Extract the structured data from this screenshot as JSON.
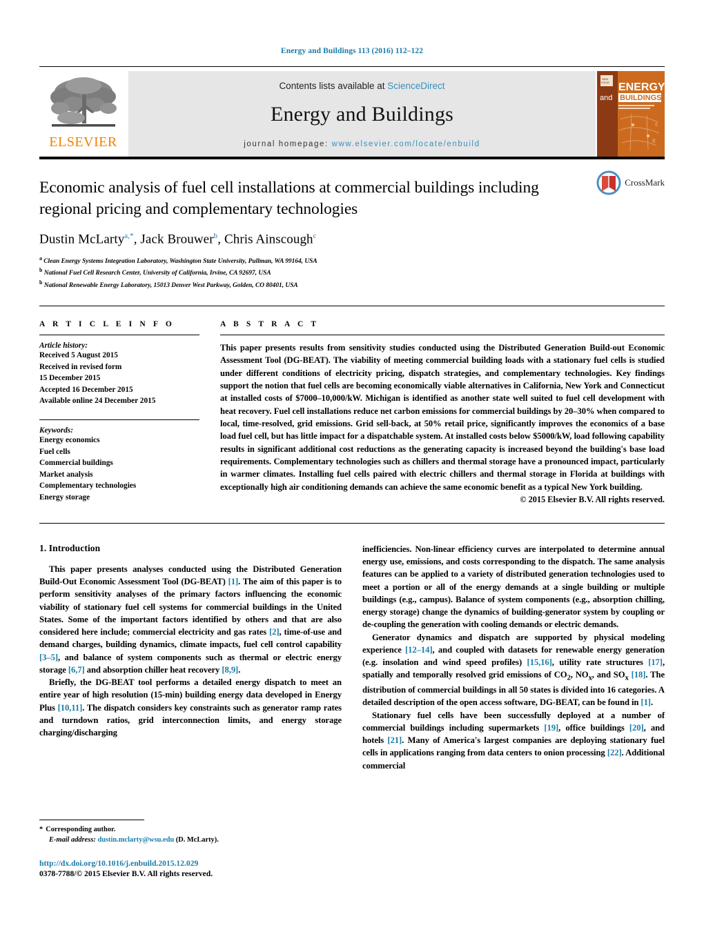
{
  "running_head": "Energy and Buildings 113 (2016) 112–122",
  "masthead": {
    "publisher_name": "ELSEVIER",
    "contents_prefix": "Contents lists available at ",
    "contents_link": "ScienceDirect",
    "journal_title": "Energy and Buildings",
    "homepage_prefix": "journal homepage: ",
    "homepage_url": "www.elsevier.com/locate/enbuild",
    "cover_line1": "ENERGY",
    "cover_line2": "and",
    "cover_line3": "BUILDINGS"
  },
  "article": {
    "title": "Economic analysis of fuel cell installations at commercial buildings including regional pricing and complementary technologies",
    "authors_html": "Dustin McLarty<sup>a,*</sup>, Jack Brouwer<sup>b</sup>, Chris Ainscough<sup>c</sup>",
    "affiliations": [
      {
        "marker": "a",
        "text": "Clean Energy Systems Integration Laboratory, Washington State University, Pullman, WA 99164, USA"
      },
      {
        "marker": "b",
        "text": "National Fuel Cell Research Center, University of California, Irvine, CA 92697, USA"
      },
      {
        "marker": "b",
        "text": "National Renewable Energy Laboratory, 15013 Denver West Parkway, Golden, CO 80401, USA"
      }
    ],
    "crossmark_label": "CrossMark"
  },
  "article_info": {
    "heading": "A R T I C L E   I N F O",
    "history_label": "Article history:",
    "history": [
      "Received 5 August 2015",
      "Received in revised form",
      "15 December 2015",
      "Accepted 16 December 2015",
      "Available online 24 December 2015"
    ],
    "keywords_label": "Keywords:",
    "keywords": [
      "Energy economics",
      "Fuel cells",
      "Commercial buildings",
      "Market analysis",
      "Complementary technologies",
      "Energy storage"
    ]
  },
  "abstract": {
    "heading": "A B S T R A C T",
    "text": "This paper presents results from sensitivity studies conducted using the Distributed Generation Build-out Economic Assessment Tool (DG-BEAT). The viability of meeting commercial building loads with a stationary fuel cells is studied under different conditions of electricity pricing, dispatch strategies, and complementary technologies. Key findings support the notion that fuel cells are becoming economically viable alternatives in California, New York and Connecticut at installed costs of $7000–10,000/kW. Michigan is identified as another state well suited to fuel cell development with heat recovery. Fuel cell installations reduce net carbon emissions for commercial buildings by 20–30% when compared to local, time-resolved, grid emissions. Grid sell-back, at 50% retail price, significantly improves the economics of a base load fuel cell, but has little impact for a dispatchable system. At installed costs below $5000/kW, load following capability results in significant additional cost reductions as the generating capacity is increased beyond the building's base load requirements. Complementary technologies such as chillers and thermal storage have a pronounced impact, particularly in warmer climates. Installing fuel cells paired with electric chillers and thermal storage in Florida at buildings with exceptionally high air conditioning demands can achieve the same economic benefit as a typical New York building.",
    "copyright": "© 2015 Elsevier B.V. All rights reserved."
  },
  "introduction": {
    "section_number_title": "1. Introduction",
    "left_paragraphs_html": [
      "This paper presents analyses conducted using the Distributed Generation Build-Out Economic Assessment Tool (DG-BEAT) <span class=\"cite\">[1]</span>. The aim of this paper is to perform sensitivity analyses of the primary factors influencing the economic viability of stationary fuel cell systems for commercial buildings in the United States. Some of the important factors identified by others and that are also considered here include; commercial electricity and gas rates <span class=\"cite\">[2]</span>, time-of-use and demand charges, building dynamics, climate impacts, fuel cell control capability <span class=\"cite\">[3–5]</span>, and balance of system components such as thermal or electric energy storage <span class=\"cite\">[6,7]</span> and absorption chiller heat recovery <span class=\"cite\">[8,9]</span>.",
      "Briefly, the DG-BEAT tool performs a detailed energy dispatch to meet an entire year of high resolution (15-min) building energy data developed in Energy Plus <span class=\"cite\">[10,11]</span>. The dispatch considers key constraints such as generator ramp rates and turndown ratios, grid interconnection limits, and energy storage charging/discharging"
    ],
    "right_paragraphs_html": [
      "inefficiencies. Non-linear efficiency curves are interpolated to determine annual energy use, emissions, and costs corresponding to the dispatch. The same analysis features can be applied to a variety of distributed generation technologies used to meet a portion or all of the energy demands at a single building or multiple buildings (e.g., campus). Balance of system components (e.g., absorption chilling, energy storage) change the dynamics of building-generator system by coupling or de-coupling the generation with cooling demands or electric demands.",
      "Generator dynamics and dispatch are supported by physical modeling experience <span class=\"cite\">[12–14]</span>, and coupled with datasets for renewable energy generation (e.g. insolation and wind speed profiles) <span class=\"cite\">[15,16]</span>, utility rate structures <span class=\"cite\">[17]</span>, spatially and temporally resolved grid emissions of CO<sub>2</sub>, NO<sub>x</sub>, and SO<sub>x</sub> <span class=\"cite\">[18]</span>. The distribution of commercial buildings in all 50 states is divided into 16 categories. A detailed description of the open access software, DG-BEAT, can be found in <span class=\"cite\">[1]</span>.",
      "Stationary fuel cells have been successfully deployed at a number of commercial buildings including supermarkets <span class=\"cite\">[19]</span>, office buildings <span class=\"cite\">[20]</span>, and hotels <span class=\"cite\">[21]</span>. Many of America's largest companies are deploying stationary fuel cells in applications ranging from data centers to onion processing <span class=\"cite\">[22]</span>. Additional commercial"
    ]
  },
  "footer": {
    "corresponding_star": "*",
    "corresponding_label": "Corresponding author.",
    "email_label": "E-mail address:",
    "email": "dustin.mclarty@wsu.edu",
    "email_suffix": "(D. McLarty).",
    "doi": "http://dx.doi.org/10.1016/j.enbuild.2015.12.029",
    "issn_copyright": "0378-7788/© 2015 Elsevier B.V. All rights reserved."
  },
  "colors": {
    "link_teal": "#1a7ba8",
    "sciencedirect_blue": "#3a8fc0",
    "elsevier_orange": "#f08000",
    "masthead_gray": "#e6e6e6",
    "cover_orange": "#cc6b1f",
    "cover_dark": "#8c3a14",
    "crossmark_blue": "#4b8fc4",
    "crossmark_red": "#c8322a"
  }
}
